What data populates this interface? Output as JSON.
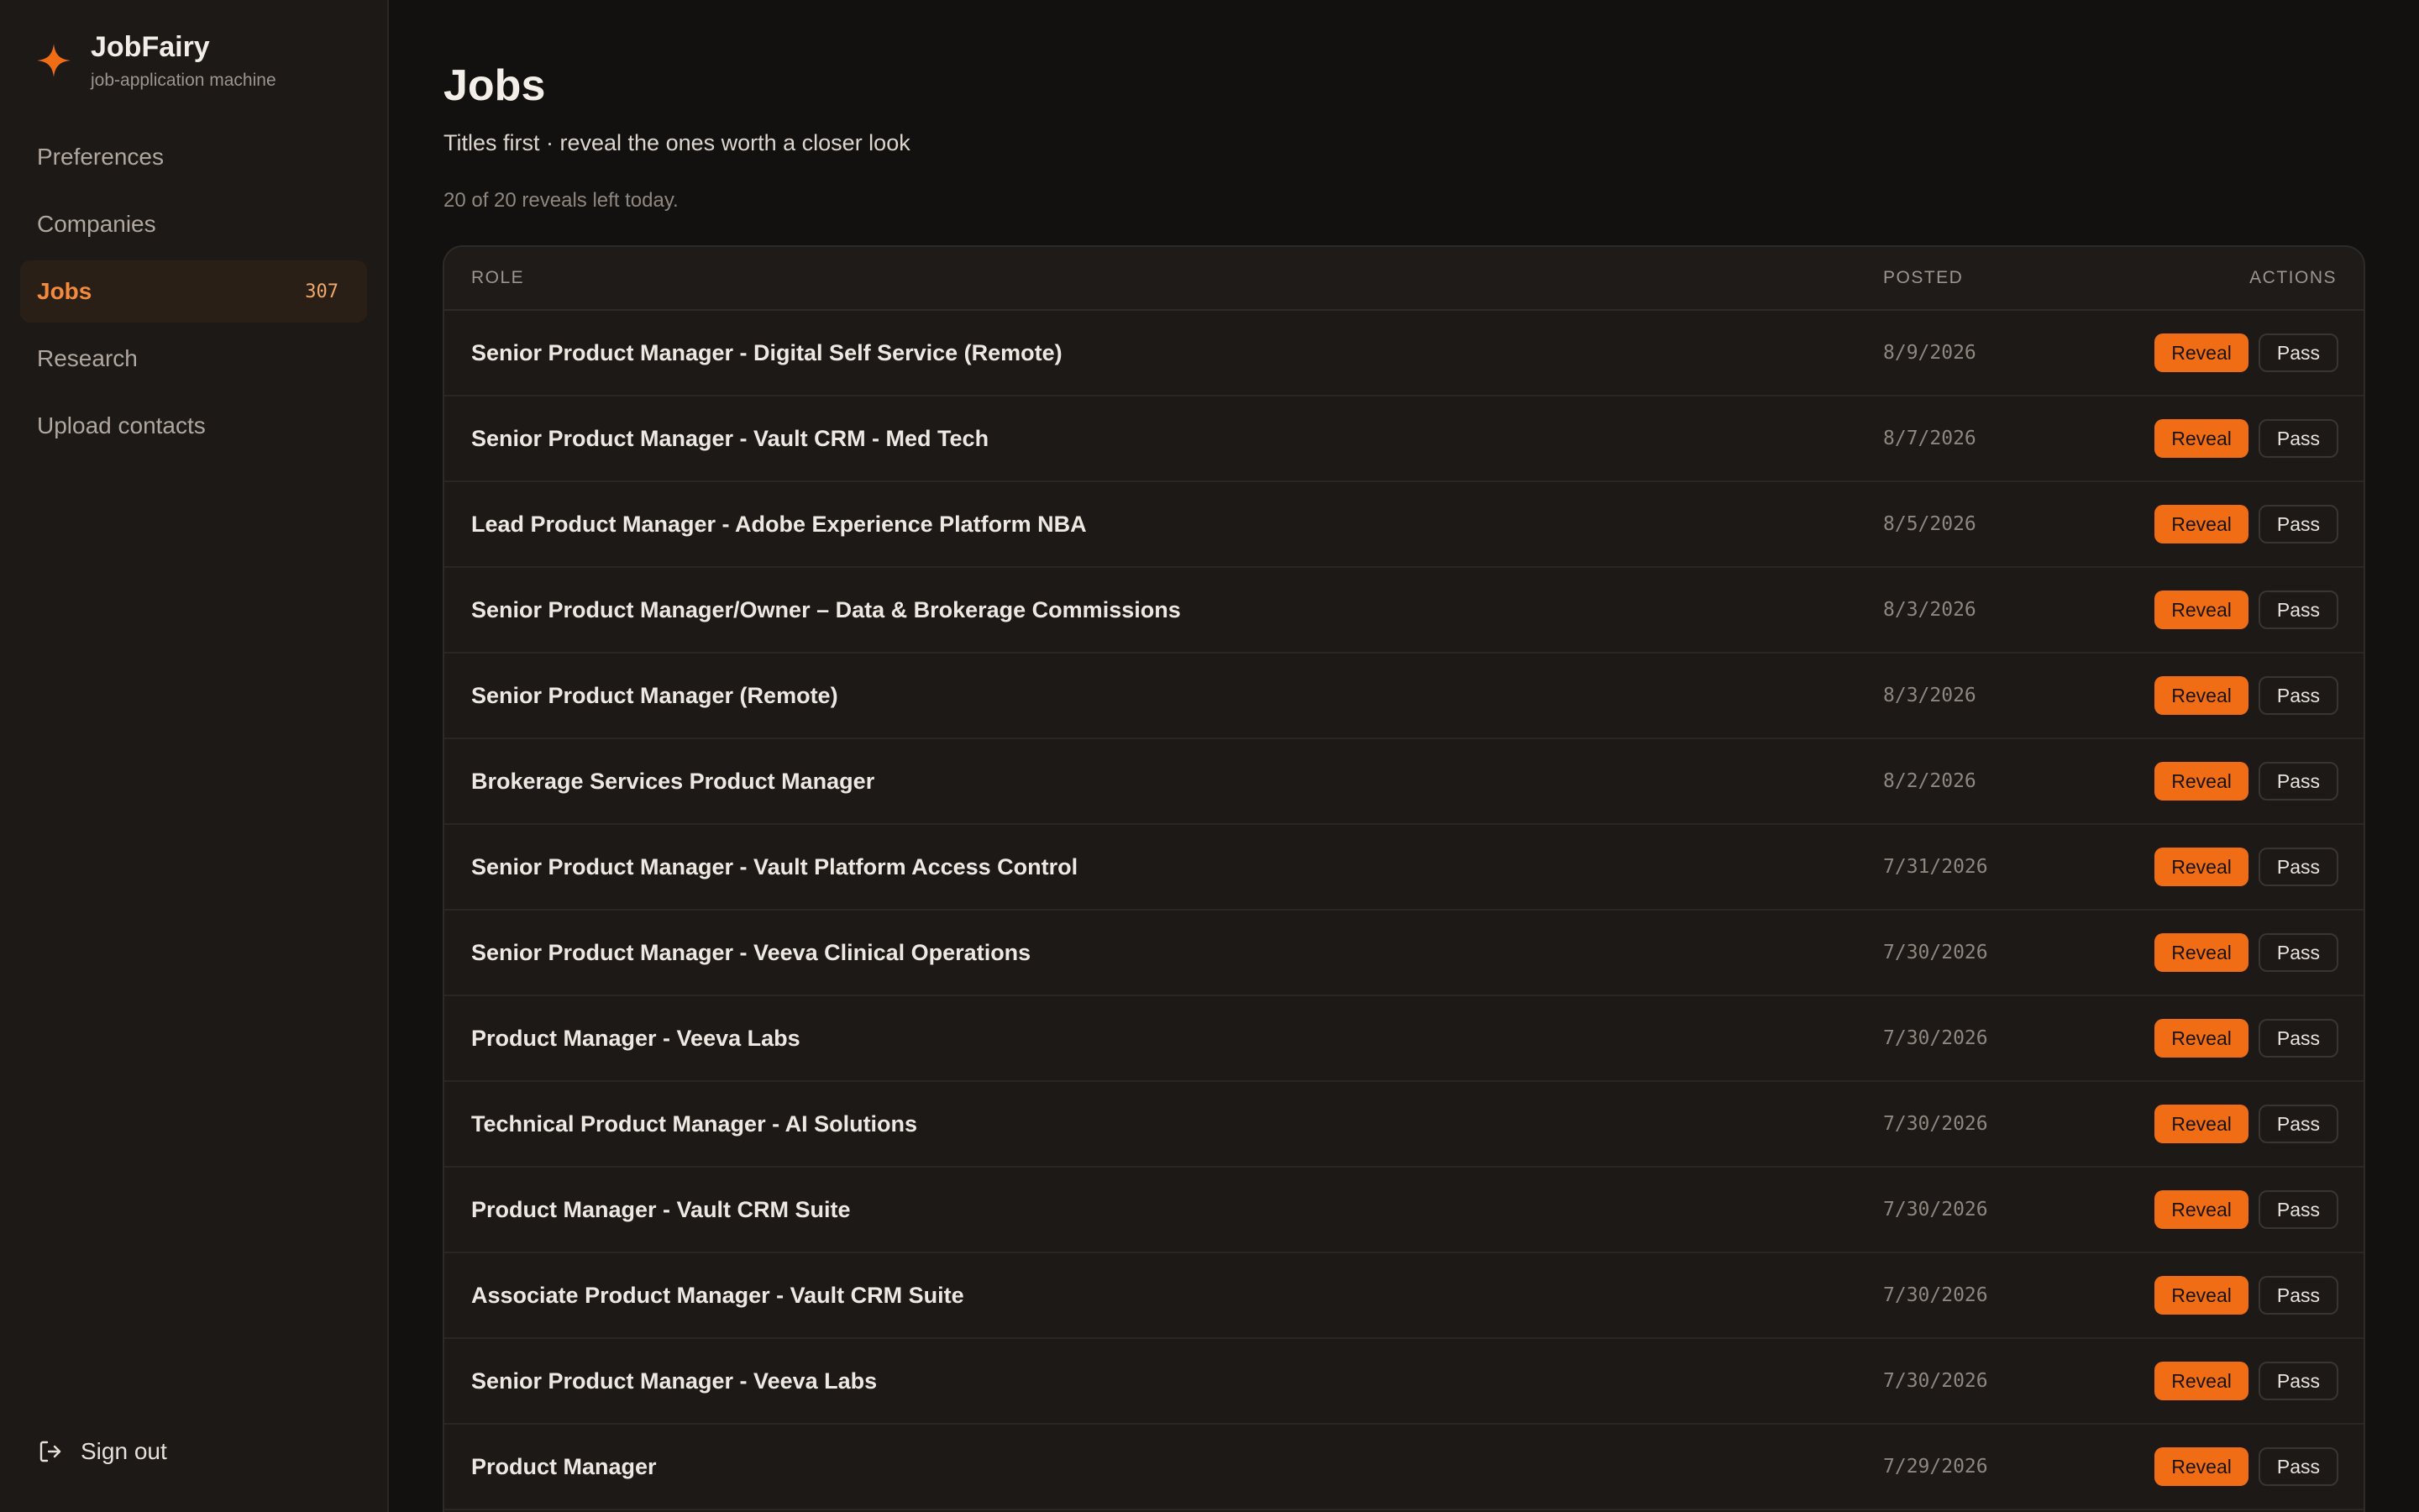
{
  "brand": {
    "name": "JobFairy",
    "tagline": "job-application machine",
    "logo_icon": "sparkle-icon",
    "accent": "#f06d16"
  },
  "nav": {
    "items": [
      {
        "label": "Preferences",
        "active": false
      },
      {
        "label": "Companies",
        "active": false
      },
      {
        "label": "Jobs",
        "active": true,
        "count": "307"
      },
      {
        "label": "Research",
        "active": false
      },
      {
        "label": "Upload contacts",
        "active": false
      }
    ],
    "sign_out": {
      "label": "Sign out",
      "icon": "sign-out-icon"
    }
  },
  "page": {
    "title": "Jobs",
    "subtitle": "Titles first · reveal the ones worth a closer look",
    "reveals_left": "20 of 20 reveals left today."
  },
  "table": {
    "headers": {
      "role": "ROLE",
      "posted": "POSTED",
      "actions": "ACTIONS"
    },
    "reveal_label": "Reveal",
    "pass_label": "Pass",
    "rows": [
      {
        "role": "Senior Product Manager - Digital Self Service (Remote)",
        "posted": "8/9/2026"
      },
      {
        "role": "Senior Product Manager - Vault CRM - Med Tech",
        "posted": "8/7/2026"
      },
      {
        "role": "Lead Product Manager - Adobe Experience Platform NBA",
        "posted": "8/5/2026"
      },
      {
        "role": "Senior Product Manager/Owner – Data & Brokerage Commissions",
        "posted": "8/3/2026"
      },
      {
        "role": "Senior Product Manager (Remote)",
        "posted": "8/3/2026"
      },
      {
        "role": "Brokerage Services Product Manager",
        "posted": "8/2/2026"
      },
      {
        "role": "Senior Product Manager - Vault Platform Access Control",
        "posted": "7/31/2026"
      },
      {
        "role": "Senior Product Manager - Veeva Clinical Operations",
        "posted": "7/30/2026"
      },
      {
        "role": "Product Manager - Veeva Labs",
        "posted": "7/30/2026"
      },
      {
        "role": "Technical Product Manager - AI Solutions",
        "posted": "7/30/2026"
      },
      {
        "role": "Product Manager - Vault CRM Suite",
        "posted": "7/30/2026"
      },
      {
        "role": "Associate Product Manager - Vault CRM Suite",
        "posted": "7/30/2026"
      },
      {
        "role": "Senior Product Manager - Veeva Labs",
        "posted": "7/30/2026"
      },
      {
        "role": "Product Manager",
        "posted": "7/29/2026"
      }
    ]
  }
}
